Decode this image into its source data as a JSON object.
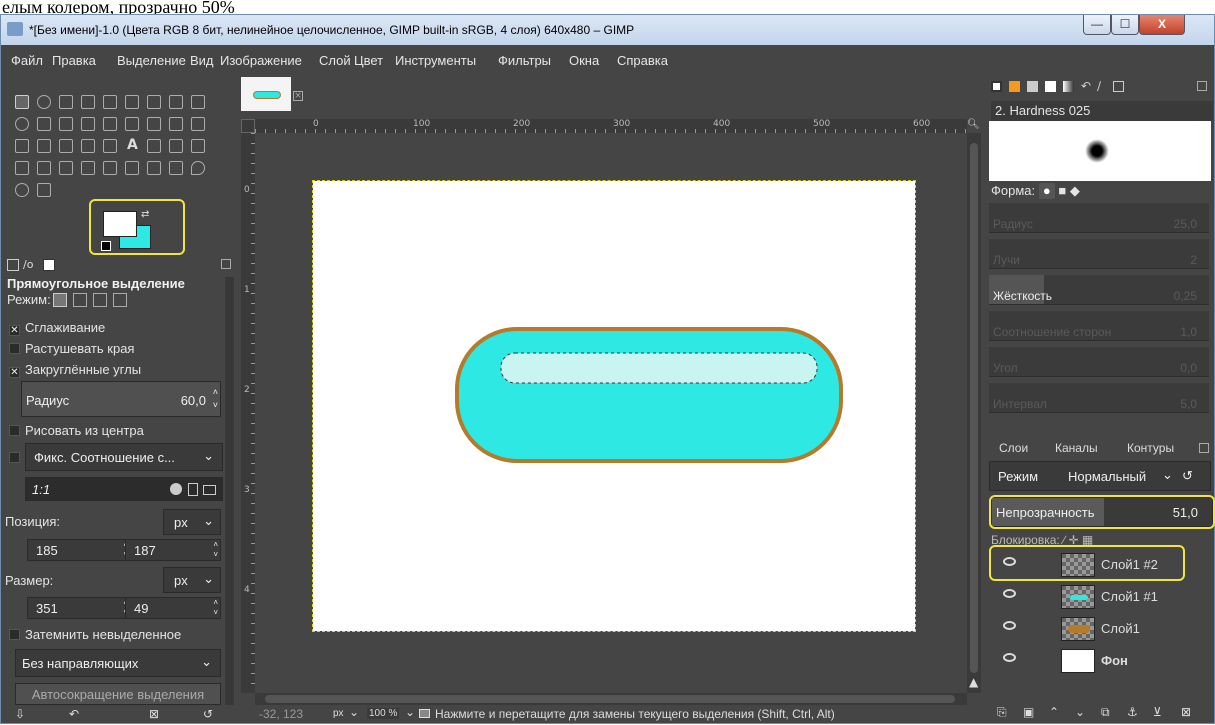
{
  "caption_fragment": "елым колером, прозрачно 50%",
  "window": {
    "title": "*[Без имени]-1.0 (Цвета RGB 8 бит, нелинейное целочисленное, GIMP built-in sRGB, 4 слоя) 640x480 – GIMP",
    "buttons": [
      "—",
      "☐",
      "X"
    ]
  },
  "menu": [
    "Файл",
    "Правка",
    "Выделение",
    "Вид",
    "Изображение",
    "Слой",
    "Цвет",
    "Инструменты",
    "Фильтры",
    "Окна",
    "Справка"
  ],
  "tool_options": {
    "title": "Прямоугольное выделение",
    "mode_label": "Режим:",
    "antialias": "Сглаживание",
    "feather": "Растушевать края",
    "rounded": "Закруглённые углы",
    "radius_label": "Радиус",
    "radius_value": "60,0",
    "from_center": "Рисовать из центра",
    "fixed_label": "Фикс. Соотношение с...",
    "ratio_value": "1:1",
    "position_label": "Позиция:",
    "unit": "px",
    "pos_x": "185",
    "pos_y": "187",
    "size_label": "Размер:",
    "size_w": "351",
    "size_h": "49",
    "darken": "Затемнить невыделенное",
    "guides": "Без направляющих",
    "autoshrink": "Автосокращение выделения"
  },
  "ruler": {
    "h_labels": [
      "0",
      "100",
      "200",
      "300",
      "400",
      "500",
      "600"
    ],
    "v_labels": [
      "0",
      "1",
      "2",
      "3",
      "4"
    ]
  },
  "status": {
    "coords": "-32, 123",
    "unit": "px",
    "zoom": "100 %",
    "message": "Нажмите и перетащите для замены текущего выделения (Shift, Ctrl, Alt)"
  },
  "brushes": {
    "selected": "2. Hardness 025",
    "shape_label": "Форма:",
    "props": [
      "Радиус",
      "Лучи",
      "Жёсткость",
      "Соотношение сторон",
      "Угол",
      "Интервал"
    ],
    "prop_values": [
      "25,0",
      "2",
      "0,25",
      "1,0",
      "0,0",
      "5,0"
    ]
  },
  "layers_panel": {
    "tabs": [
      "Слои",
      "Каналы",
      "Контуры"
    ],
    "mode_label": "Режим",
    "mode_value": "Нормальный",
    "opacity_label": "Непрозрачность",
    "opacity_value": "51,0",
    "lock_label": "Блокировка:",
    "layers": [
      {
        "name": "Слой1 #2"
      },
      {
        "name": "Слой1 #1"
      },
      {
        "name": "Слой1"
      },
      {
        "name": "Фон"
      }
    ]
  },
  "colors": {
    "fg": "#ffffff",
    "bg": "#2ee8e3",
    "highlight": "#f2e63a",
    "pill_fill": "#2ee8e3",
    "pill_stroke": "#b57a2a",
    "inner_fill": "#c8f4f2"
  }
}
